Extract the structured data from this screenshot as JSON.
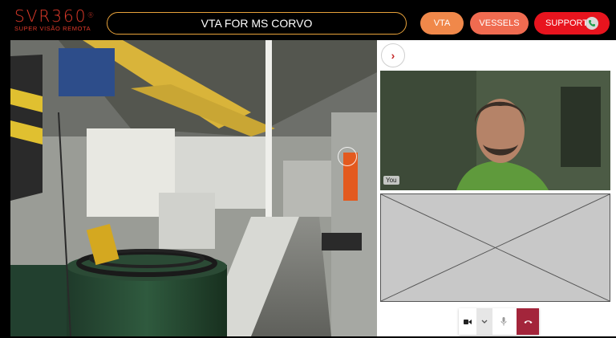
{
  "header": {
    "logo_main": "SVR360",
    "logo_reg": "®",
    "logo_sub": "SUPER VISÃO REMOTA",
    "title": "VTA FOR MS CORVO",
    "nav": {
      "vta": "VTA",
      "vessels": "VESSELS",
      "support": "SUPPORT"
    }
  },
  "sidebar": {
    "collapse_glyph": "›",
    "local_label": "You"
  },
  "colors": {
    "brand": "#e03a2a",
    "title_border": "#e8a23a",
    "vta": "#f0884a",
    "vessels": "#f06b50",
    "support": "#e8141e",
    "end_call": "#a3253b"
  },
  "icons": [
    "phone-icon",
    "hotspot-icon",
    "camera-icon",
    "chevron-down-icon",
    "microphone-icon",
    "end-call-icon"
  ]
}
